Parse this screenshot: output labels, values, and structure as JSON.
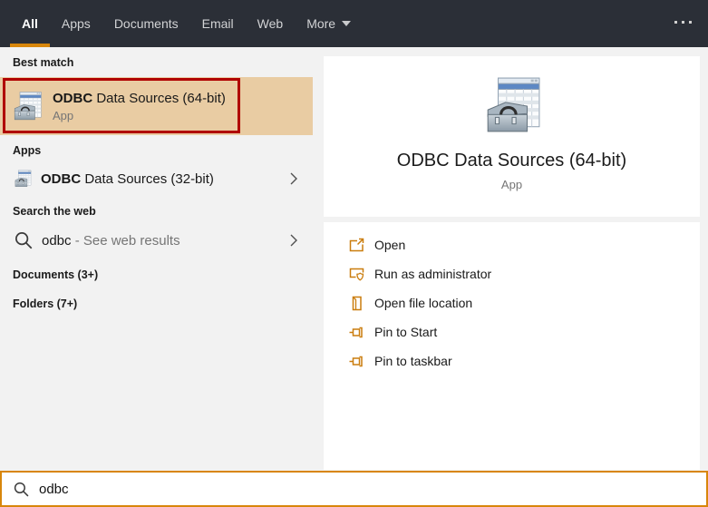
{
  "colors": {
    "accent_orange": "#d8860b",
    "action_icon_orange": "#ca7d0e",
    "best_match_highlight": "#e9cca3",
    "annotation_red": "#b00000",
    "topbar_bg": "#2b2f37",
    "panel_gray": "#f2f2f2"
  },
  "topbar": {
    "tabs": [
      {
        "label": "All",
        "active": true
      },
      {
        "label": "Apps",
        "active": false
      },
      {
        "label": "Documents",
        "active": false
      },
      {
        "label": "Email",
        "active": false
      },
      {
        "label": "Web",
        "active": false
      },
      {
        "label": "More",
        "active": false,
        "has_dropdown": true
      }
    ]
  },
  "left_panel": {
    "best_match": {
      "header": "Best match",
      "result": {
        "title_bold": "ODBC",
        "title_rest": " Data Sources (64-bit)",
        "subtitle": "App"
      }
    },
    "apps": {
      "header": "Apps",
      "result": {
        "title_bold": "ODBC",
        "title_rest": " Data Sources (32-bit)"
      }
    },
    "web": {
      "header": "Search the web",
      "result": {
        "query": "odbc",
        "suffix": " - See web results"
      }
    },
    "documents_header": "Documents (3+)",
    "folders_header": "Folders (7+)"
  },
  "preview_panel": {
    "title": "ODBC Data Sources (64-bit)",
    "subtitle": "App",
    "actions": [
      {
        "icon": "open-icon",
        "label": "Open"
      },
      {
        "icon": "run-as-admin-icon",
        "label": "Run as administrator"
      },
      {
        "icon": "file-location-icon",
        "label": "Open file location"
      },
      {
        "icon": "pin-icon",
        "label": "Pin to Start"
      },
      {
        "icon": "pin-icon",
        "label": "Pin to taskbar"
      }
    ]
  },
  "search_bar": {
    "value": "odbc"
  }
}
